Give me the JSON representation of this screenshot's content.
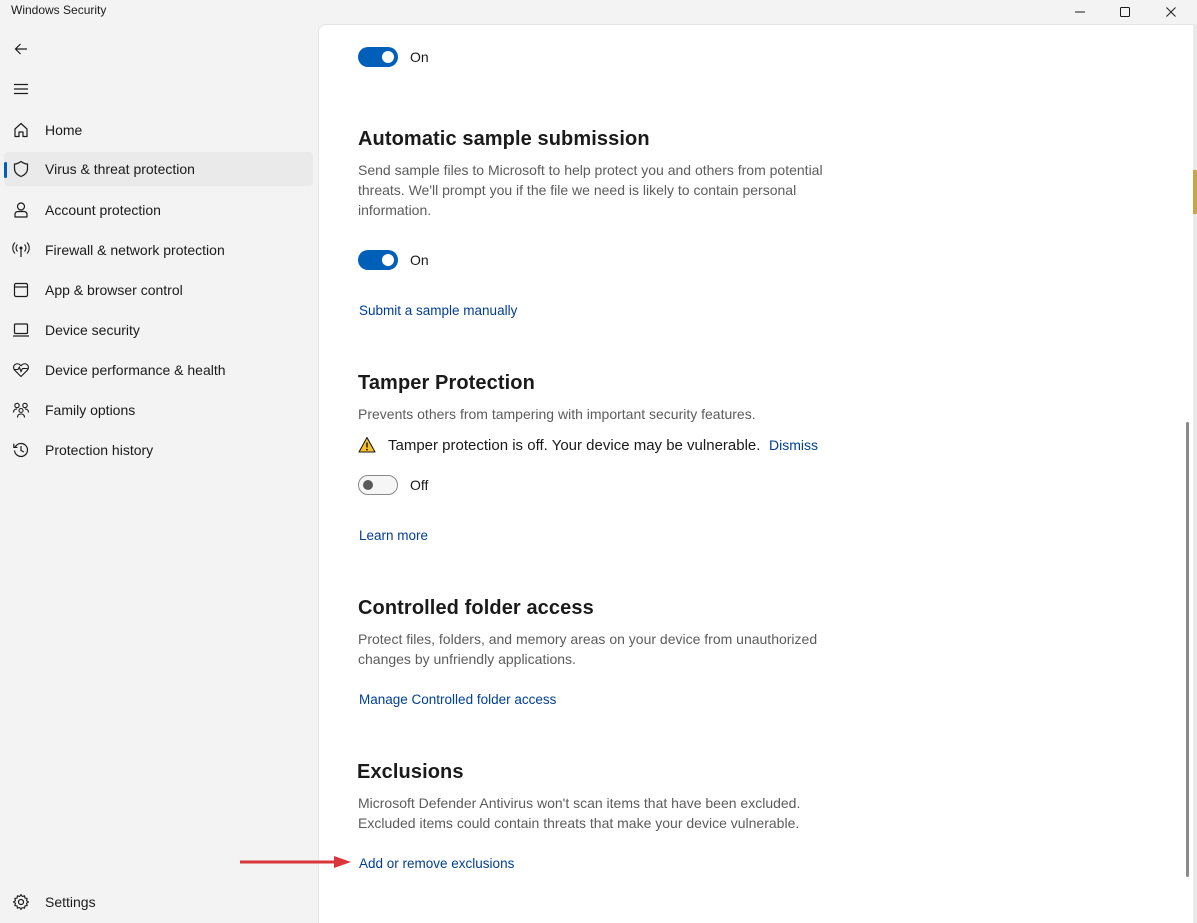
{
  "window": {
    "title": "Windows Security"
  },
  "sidebar": {
    "items": [
      {
        "label": "Home",
        "icon": "home-icon"
      },
      {
        "label": "Virus & threat protection",
        "icon": "shield-icon",
        "selected": true
      },
      {
        "label": "Account protection",
        "icon": "person-icon"
      },
      {
        "label": "Firewall & network protection",
        "icon": "antenna-icon"
      },
      {
        "label": "App & browser control",
        "icon": "app-window-icon"
      },
      {
        "label": "Device security",
        "icon": "laptop-icon"
      },
      {
        "label": "Device performance & health",
        "icon": "heart-pulse-icon"
      },
      {
        "label": "Family options",
        "icon": "family-icon"
      },
      {
        "label": "Protection history",
        "icon": "history-icon"
      }
    ],
    "settings_label": "Settings",
    "accent_color": "#005fb8"
  },
  "content": {
    "top_toggle": {
      "state_label": "On",
      "on": true
    },
    "sample_submission": {
      "heading": "Automatic sample submission",
      "description": "Send sample files to Microsoft to help protect you and others from potential threats. We'll prompt you if the file we need is likely to contain personal information.",
      "toggle": {
        "state_label": "On",
        "on": true
      },
      "link": "Submit a sample manually"
    },
    "tamper": {
      "heading": "Tamper Protection",
      "description": "Prevents others from tampering with important security features.",
      "warning": "Tamper protection is off. Your device may be vulnerable.",
      "dismiss_label": "Dismiss",
      "toggle": {
        "state_label": "Off",
        "on": false
      },
      "link": "Learn more"
    },
    "controlled_folder": {
      "heading": "Controlled folder access",
      "description": "Protect files, folders, and memory areas on your device from unauthorized changes by unfriendly applications.",
      "link": "Manage Controlled folder access"
    },
    "exclusions": {
      "heading": "Exclusions",
      "description": "Microsoft Defender Antivirus won't scan items that have been excluded. Excluded items could contain threats that make your device vulnerable.",
      "link": "Add or remove exclusions"
    },
    "link_color": "#003e92",
    "annotation_arrow_color": "#d9353a"
  }
}
